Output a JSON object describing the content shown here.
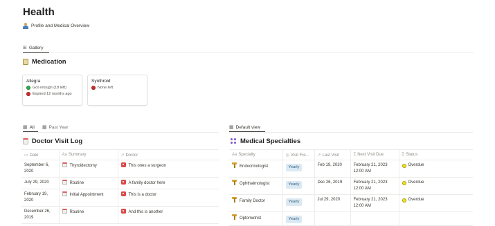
{
  "page": {
    "title": "Health",
    "profile_link": "Profile and Medical Overview"
  },
  "gallery_tabs": [
    {
      "label": "Gallery",
      "icon": "gallery-grid-icon",
      "active": true
    }
  ],
  "medication": {
    "title": "Medication",
    "cards": [
      {
        "name": "Allegra",
        "lines": [
          {
            "status": "green",
            "text": "Got enough (18 left)"
          },
          {
            "status": "red",
            "text": "Expired 12 months ago"
          }
        ]
      },
      {
        "name": "Synthroid",
        "lines": [
          {
            "status": "red",
            "text": "None left"
          }
        ]
      }
    ]
  },
  "visit_log": {
    "tabs": [
      {
        "label": "All",
        "icon": "table-icon",
        "active": true
      },
      {
        "label": "Past Year",
        "icon": "table-icon",
        "active": false
      }
    ],
    "title": "Doctor Visit Log",
    "columns": [
      {
        "label": "Date",
        "icon": "calendar-icon"
      },
      {
        "label": "Summary",
        "icon": "text-icon"
      },
      {
        "label": "Doctor",
        "icon": "relation-icon"
      }
    ],
    "rows": [
      {
        "date": "September 6, 2020",
        "summary": "Thyroidectomy",
        "doctor": "This ones a surgeon"
      },
      {
        "date": "July 29, 2020",
        "summary": "Routine",
        "doctor": "A family doctor here"
      },
      {
        "date": "February 19, 2020",
        "summary": "Initial Appointment",
        "doctor": "This is a doctor"
      },
      {
        "date": "December 26, 2019",
        "summary": "Routine",
        "doctor": "And this is another"
      }
    ]
  },
  "specialties": {
    "tabs": [
      {
        "label": "Default view",
        "icon": "table-icon",
        "active": true
      }
    ],
    "title": "Medical Specialties",
    "columns": [
      {
        "label": "Specialty",
        "icon": "text-icon"
      },
      {
        "label": "Visit Fre...",
        "icon": "select-icon"
      },
      {
        "label": "Last Visit",
        "icon": "formula-icon"
      },
      {
        "label": "Next Visit Due",
        "icon": "formula-icon"
      },
      {
        "label": "Status",
        "icon": "formula-icon"
      }
    ],
    "rows": [
      {
        "specialty": "Endocrinologist",
        "frequency": "Yearly",
        "last_visit": "Feb 19, 2020",
        "next_due": "February 21, 2023 12:00 AM",
        "status": "Overdue"
      },
      {
        "specialty": "Ophthalmologist",
        "frequency": "Yearly",
        "last_visit": "Dec 26, 2019",
        "next_due": "February 21, 2023 12:00 AM",
        "status": "Overdue"
      },
      {
        "specialty": "Family Doctor",
        "frequency": "Yearly",
        "last_visit": "Jul 29, 2020",
        "next_due": "February 21, 2023 12:00 AM",
        "status": "Overdue"
      },
      {
        "specialty": "Optometrist",
        "frequency": "Yearly",
        "last_visit": "",
        "next_due": "",
        "status": ""
      }
    ]
  },
  "colors": {
    "accent_red": "#e05d5d",
    "tag_bg": "#dbe9f3",
    "status_yellow": "#f2e21a"
  }
}
